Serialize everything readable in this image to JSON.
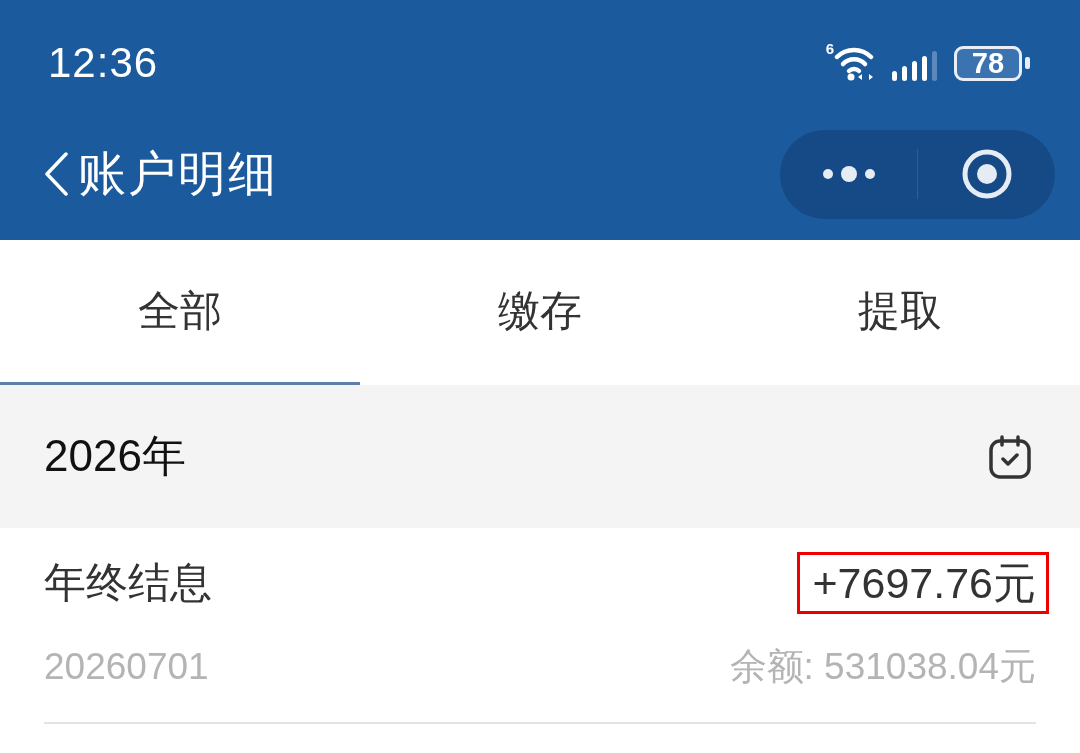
{
  "status_bar": {
    "time": "12:36",
    "wifi_badge": "6",
    "battery": "78"
  },
  "nav_bar": {
    "title": "账户明细"
  },
  "tabs": [
    {
      "label": "全部",
      "selected": true
    },
    {
      "label": "缴存",
      "selected": false
    },
    {
      "label": "提取",
      "selected": false
    }
  ],
  "year_header": {
    "label": "2026年"
  },
  "transactions": [
    {
      "title": "年终结息",
      "amount": "+7697.76元",
      "highlighted": true,
      "date": "20260701",
      "balance": "余额: 531038.04元"
    }
  ]
}
